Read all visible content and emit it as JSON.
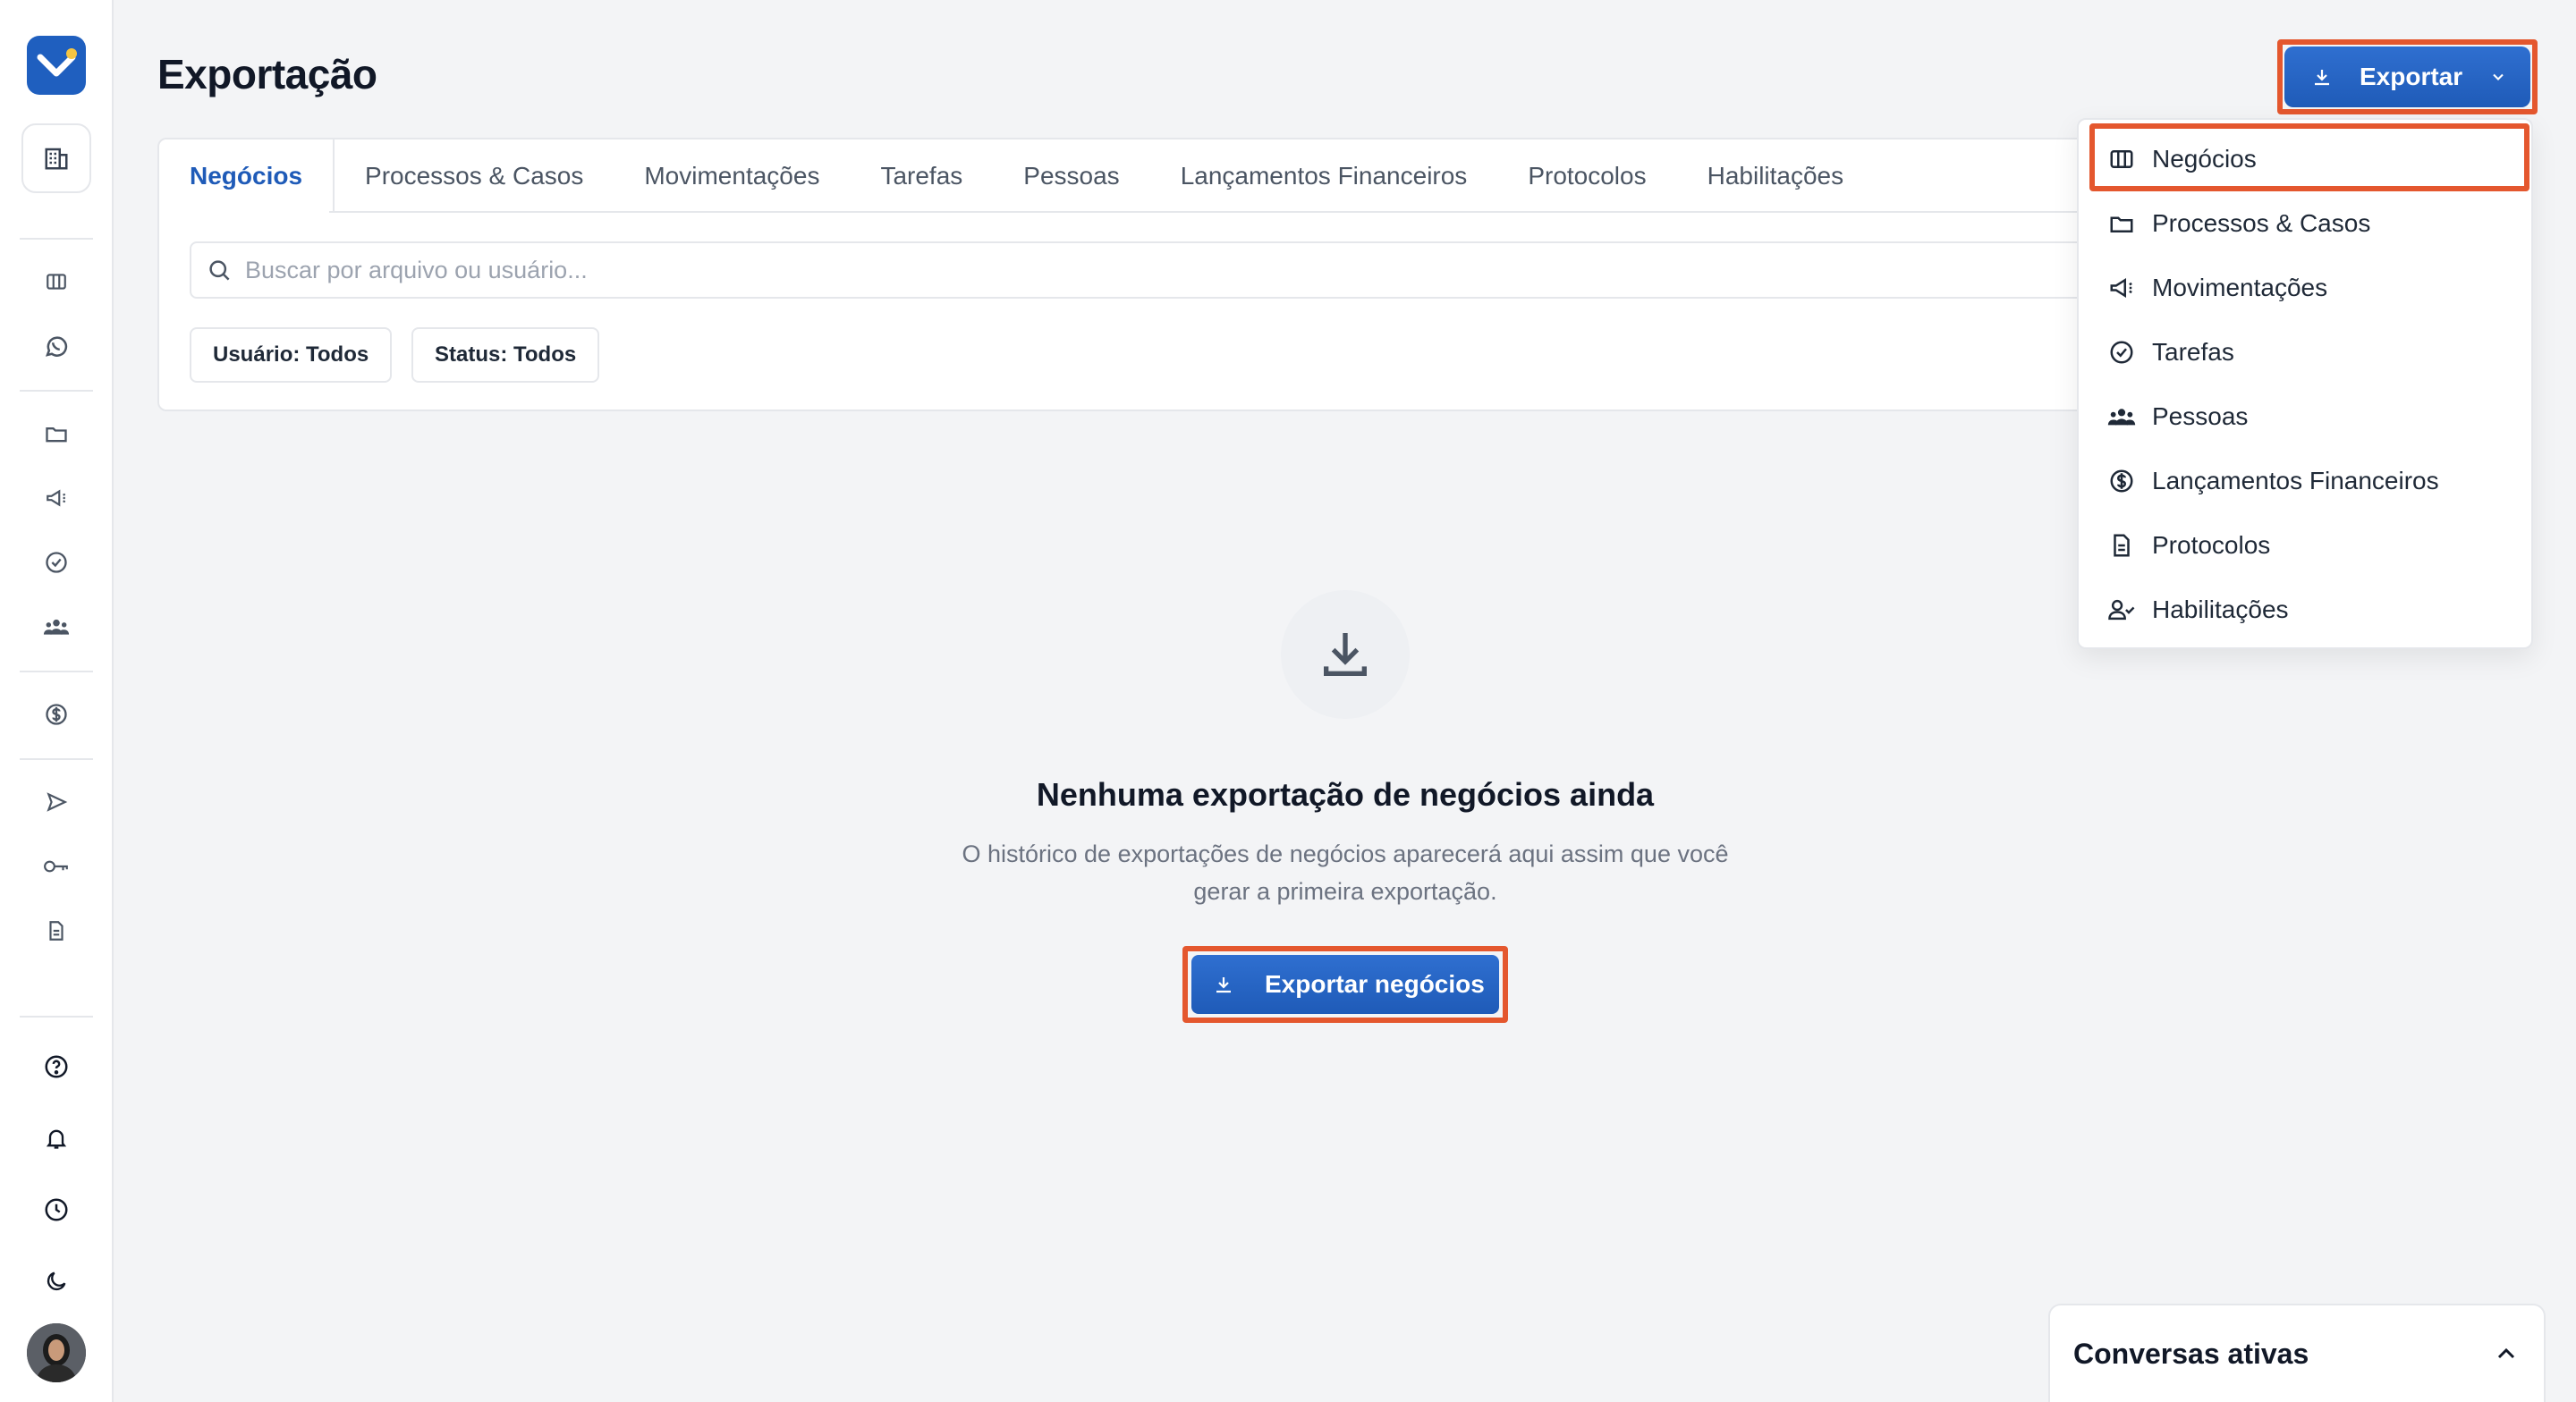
{
  "app": {
    "page_title": "Exportação",
    "accent_color": "#1f5bb8",
    "highlight_color": "#e4572e"
  },
  "sidebar": {
    "items": [
      {
        "icon": "building-icon"
      },
      {
        "icon": "kanban-icon"
      },
      {
        "icon": "whatsapp-icon"
      },
      {
        "icon": "folder-icon"
      },
      {
        "icon": "megaphone-icon"
      },
      {
        "icon": "check-circle-icon"
      },
      {
        "icon": "people-icon"
      },
      {
        "icon": "dollar-icon"
      },
      {
        "icon": "send-icon"
      },
      {
        "icon": "key-icon"
      },
      {
        "icon": "document-icon"
      },
      {
        "icon": "help-icon"
      },
      {
        "icon": "bell-icon"
      },
      {
        "icon": "clock-icon"
      },
      {
        "icon": "moon-icon"
      },
      {
        "icon": "avatar"
      }
    ]
  },
  "header": {
    "export_button": "Exportar"
  },
  "tabs": [
    {
      "label": "Negócios",
      "active": true
    },
    {
      "label": "Processos & Casos"
    },
    {
      "label": "Movimentações"
    },
    {
      "label": "Tarefas"
    },
    {
      "label": "Pessoas"
    },
    {
      "label": "Lançamentos Financeiros"
    },
    {
      "label": "Protocolos"
    },
    {
      "label": "Habilitações"
    }
  ],
  "search": {
    "placeholder": "Buscar por arquivo ou usuário..."
  },
  "filters": {
    "user": "Usuário: Todos",
    "status": "Status: Todos"
  },
  "empty_state": {
    "title": "Nenhuma exportação de negócios ainda",
    "description_line1": "O histórico de exportações de negócios aparecerá aqui assim que você",
    "description_line2": "gerar a primeira exportação.",
    "cta": "Exportar negócios"
  },
  "dropdown": {
    "items": [
      {
        "label": "Negócios",
        "icon": "kanban-icon",
        "selected": true
      },
      {
        "label": "Processos & Casos",
        "icon": "folder-icon"
      },
      {
        "label": "Movimentações",
        "icon": "megaphone-icon"
      },
      {
        "label": "Tarefas",
        "icon": "check-circle-icon"
      },
      {
        "label": "Pessoas",
        "icon": "people-icon"
      },
      {
        "label": "Lançamentos Financeiros",
        "icon": "dollar-icon"
      },
      {
        "label": "Protocolos",
        "icon": "document-icon"
      },
      {
        "label": "Habilitações",
        "icon": "user-check-icon"
      }
    ]
  },
  "chat": {
    "title": "Conversas ativas"
  }
}
